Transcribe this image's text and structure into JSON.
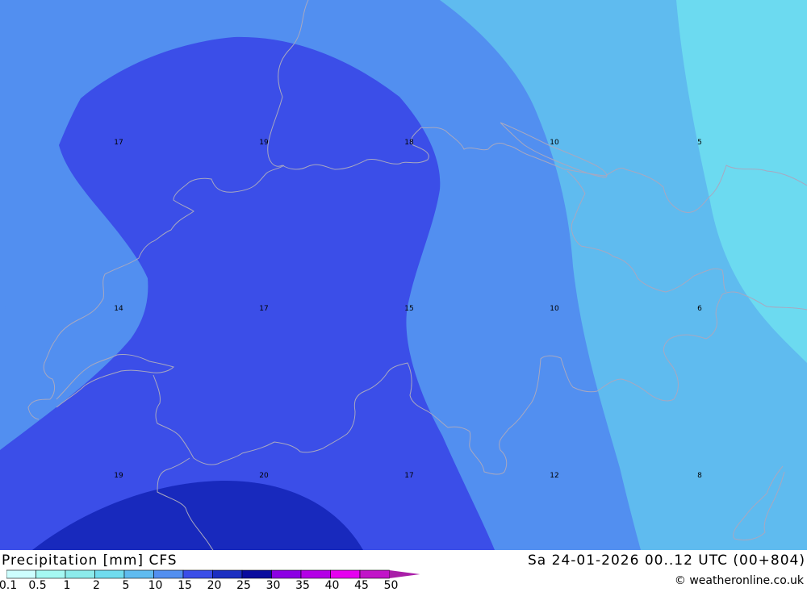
{
  "title": "Precipitation [mm] CFS",
  "datetime": "Sa 24-01-2026 00..12 UTC (00+804)",
  "credit": "© weatheronline.co.uk",
  "legend": {
    "labels": [
      "0.1",
      "0.5",
      "1",
      "2",
      "5",
      "10",
      "15",
      "20",
      "25",
      "30",
      "35",
      "40",
      "45",
      "50"
    ],
    "colors": [
      "#cdfefe",
      "#a5f8f2",
      "#8cebeb",
      "#70dcee",
      "#5fbbef",
      "#528ff0",
      "#3b4ee8",
      "#1c2fc1",
      "#0a0c9e",
      "#8c00e4",
      "#b400e6",
      "#e600f0",
      "#c114c8",
      "#a91ea8"
    ]
  },
  "map_values": [
    {
      "text": "17"
    },
    {
      "text": "19"
    },
    {
      "text": "18"
    },
    {
      "text": "10"
    },
    {
      "text": "5"
    },
    {
      "text": "14"
    },
    {
      "text": "17"
    },
    {
      "text": "15"
    },
    {
      "text": "10"
    },
    {
      "text": "6"
    },
    {
      "text": "19"
    },
    {
      "text": "20"
    },
    {
      "text": "17"
    },
    {
      "text": "12"
    },
    {
      "text": "8"
    }
  ]
}
